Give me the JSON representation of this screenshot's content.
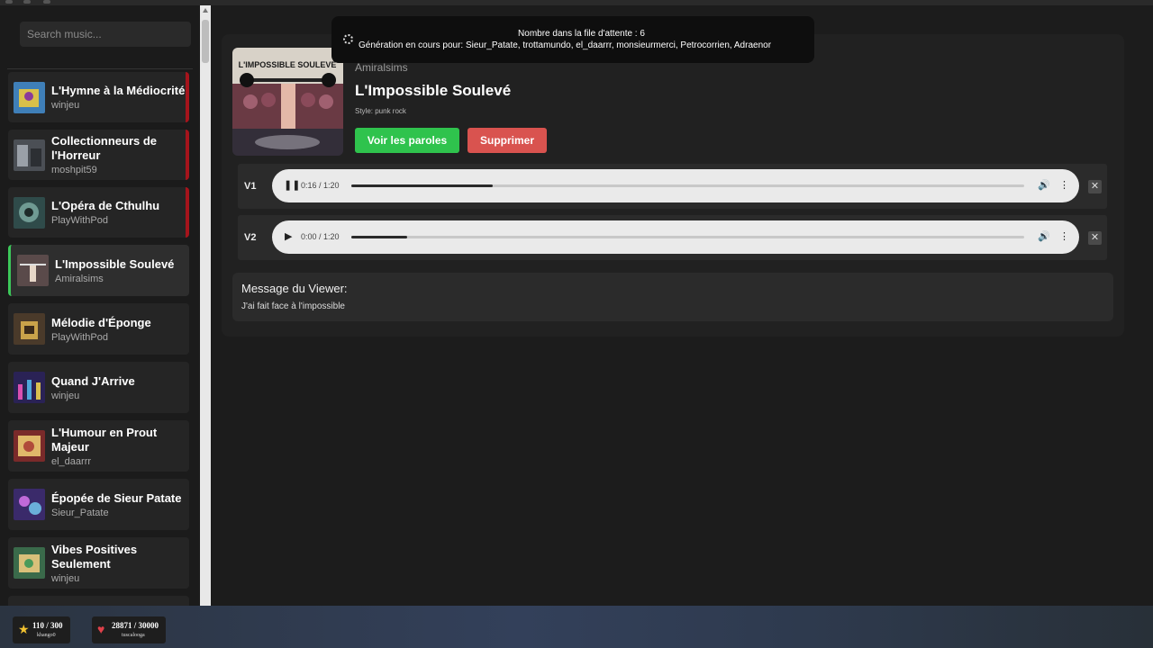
{
  "sidebar": {
    "search_placeholder": "Search music...",
    "items": [
      {
        "title": "L'Hymne à la Médiocrité",
        "author": "winjeu"
      },
      {
        "title": "Collectionneurs de l'Horreur",
        "author": "moshpit59"
      },
      {
        "title": "L'Opéra de Cthulhu",
        "author": "PlayWithPod"
      },
      {
        "title": "L'Impossible Soulevé",
        "author": "Amiralsims"
      },
      {
        "title": "Mélodie d'Éponge",
        "author": "PlayWithPod"
      },
      {
        "title": "Quand J'Arrive",
        "author": "winjeu"
      },
      {
        "title": "L'Humour en Prout Majeur",
        "author": "el_daarrr"
      },
      {
        "title": "Épopée de Sieur Patate",
        "author": "Sieur_Patate"
      },
      {
        "title": "Vibes Positives Seulement",
        "author": "winjeu"
      }
    ]
  },
  "toast": {
    "line1": "Nombre dans la file d'attente : 6",
    "line2": "Génération en cours pour: Sieur_Patate, trottamundo, el_daarrr, monsieurmerci, Petrocorrien, Adraenor"
  },
  "song": {
    "author": "Amiralsims",
    "title": "L'Impossible Soulevé",
    "style": "Style: punk rock",
    "lyrics_button": "Voir les paroles",
    "delete_button": "Supprimer",
    "cover_text": "L'IMPOSSIBLE SOULEVÉ"
  },
  "versions": [
    {
      "label": "V1",
      "time": "0:16 / 1:20",
      "progress": 0.21,
      "state": "playing"
    },
    {
      "label": "V2",
      "time": "0:00 / 1:20",
      "progress": 0.083,
      "state": "paused"
    }
  ],
  "message": {
    "title": "Message du Viewer:",
    "body": "J'ai fait face à l'impossible"
  },
  "footer": {
    "stat1": {
      "value": "110 / 300",
      "user": "khango0"
    },
    "stat2": {
      "value": "28871 / 30000",
      "user": "tuscalooga"
    }
  },
  "colors": {
    "accent_green": "#2fc34d",
    "delete_red": "#d9534f",
    "flag_red": "#a5141c"
  }
}
